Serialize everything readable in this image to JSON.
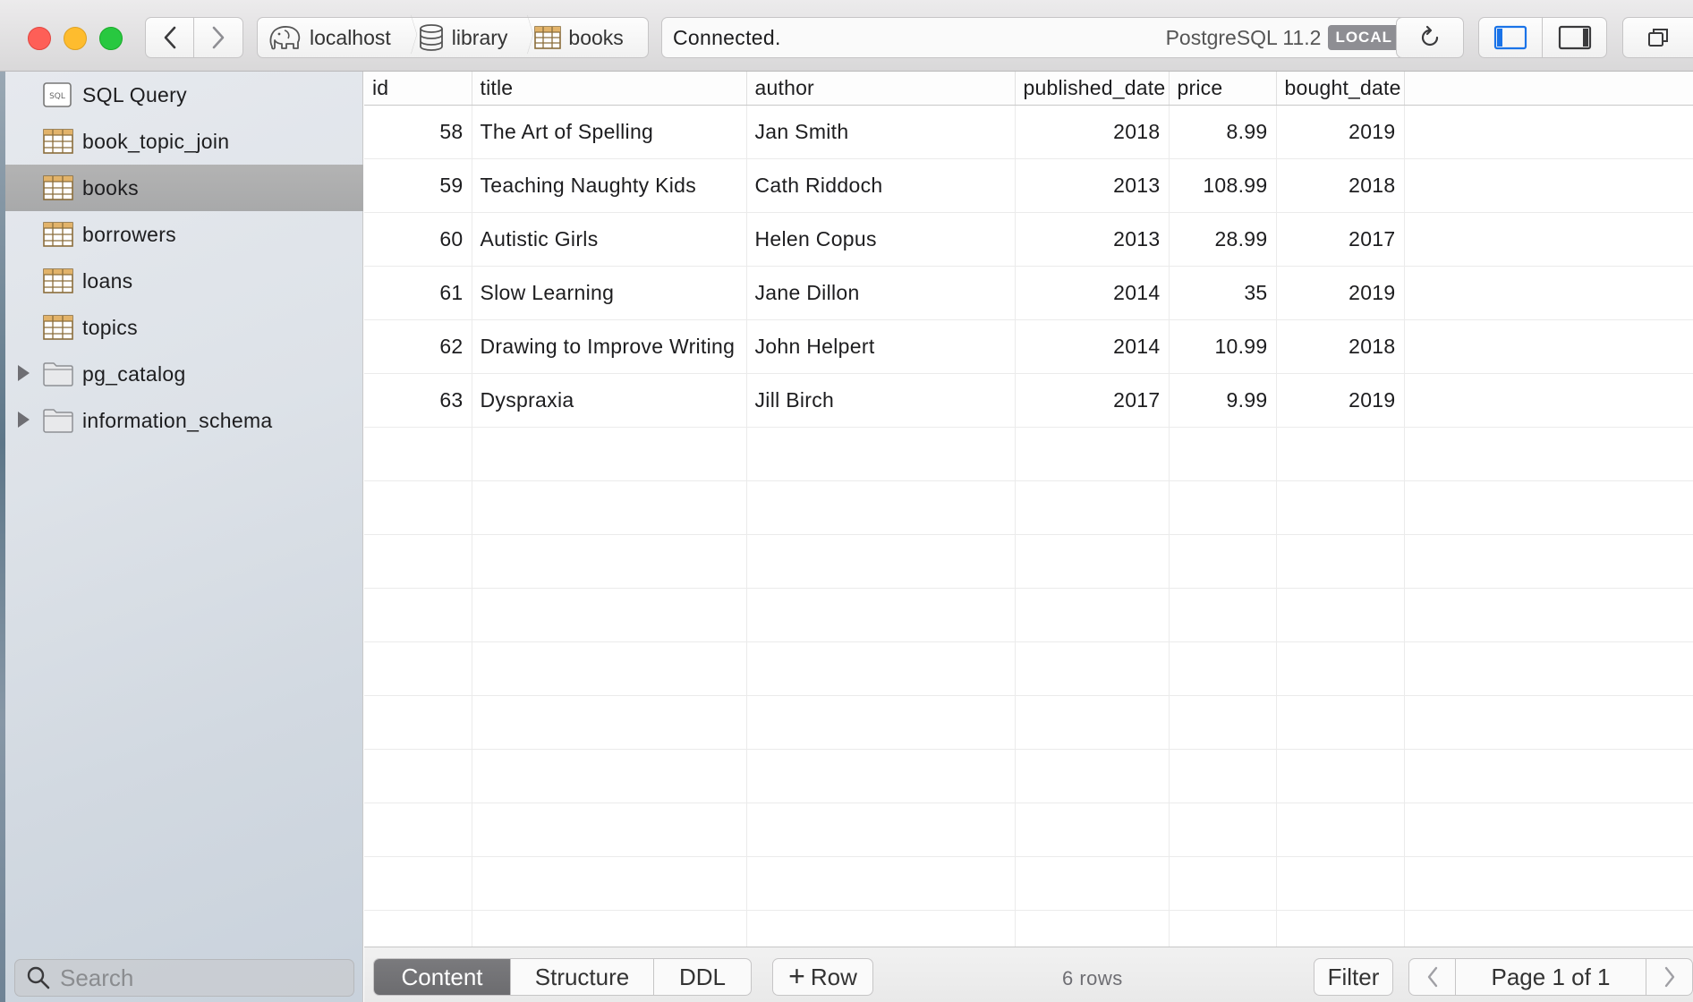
{
  "toolbar": {
    "breadcrumb": {
      "server": "localhost",
      "database": "library",
      "table": "books"
    },
    "status": {
      "message": "Connected.",
      "version": "PostgreSQL 11.2",
      "badge": "LOCAL"
    }
  },
  "sidebar": {
    "items": [
      {
        "label": "SQL Query",
        "icon": "sql-query-icon"
      },
      {
        "label": "book_topic_join",
        "icon": "table-icon"
      },
      {
        "label": "books",
        "icon": "table-icon",
        "selected": true
      },
      {
        "label": "borrowers",
        "icon": "table-icon"
      },
      {
        "label": "loans",
        "icon": "table-icon"
      },
      {
        "label": "topics",
        "icon": "table-icon"
      },
      {
        "label": "pg_catalog",
        "icon": "folder-icon"
      },
      {
        "label": "information_schema",
        "icon": "folder-icon"
      }
    ],
    "search_placeholder": "Search"
  },
  "grid": {
    "columns": [
      "id",
      "title",
      "author",
      "published_date",
      "price",
      "bought_date"
    ],
    "rows": [
      [
        "58",
        "The Art of Spelling",
        "Jan Smith",
        "2018",
        "8.99",
        "2019"
      ],
      [
        "59",
        "Teaching Naughty Kids",
        "Cath Riddoch",
        "2013",
        "108.99",
        "2018"
      ],
      [
        "60",
        "Autistic Girls",
        "Helen Copus",
        "2013",
        "28.99",
        "2017"
      ],
      [
        "61",
        "Slow Learning",
        "Jane Dillon",
        "2014",
        "35",
        "2019"
      ],
      [
        "62",
        "Drawing to Improve Writing",
        "John Helpert",
        "2014",
        "10.99",
        "2018"
      ],
      [
        "63",
        "Dyspraxia",
        "Jill Birch",
        "2017",
        "9.99",
        "2019"
      ]
    ]
  },
  "bottombar": {
    "tabs": [
      "Content",
      "Structure",
      "DDL"
    ],
    "active_tab": "Content",
    "add_row_label": "Row",
    "row_count": "6 rows",
    "filter_label": "Filter",
    "page_label": "Page 1 of 1"
  },
  "colors": {
    "selection": "#aaaaaa",
    "active_tab": "#707073",
    "accent": "#1a73e8"
  }
}
